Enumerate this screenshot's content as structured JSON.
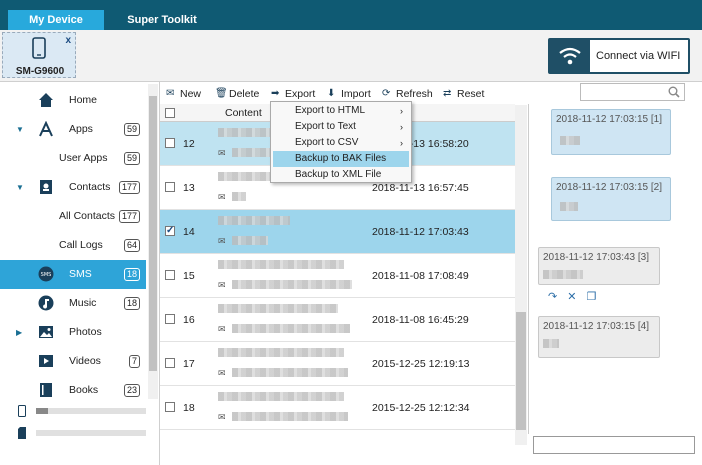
{
  "tabs": {
    "my_device": "My Device",
    "super_toolkit": "Super Toolkit"
  },
  "device": {
    "name": "SM-G9600",
    "close": "x"
  },
  "wifi_button": {
    "label": "Connect via WIFI"
  },
  "sidebar": {
    "items": [
      {
        "label": "Home",
        "icon": "home-icon"
      },
      {
        "label": "Apps",
        "badge": "59",
        "icon": "apps-icon",
        "arrow": "▼"
      },
      {
        "label": "User Apps",
        "badge": "59"
      },
      {
        "label": "Contacts",
        "badge": "177",
        "icon": "contacts-icon",
        "arrow": "▼"
      },
      {
        "label": "All Contacts",
        "badge": "177"
      },
      {
        "label": "Call Logs",
        "badge": "64"
      },
      {
        "label": "SMS",
        "badge": "18",
        "icon": "sms-icon"
      },
      {
        "label": "Music",
        "badge": "18",
        "icon": "music-icon"
      },
      {
        "label": "Photos",
        "icon": "photos-icon",
        "arrow": "▶"
      },
      {
        "label": "Videos",
        "badge": "7",
        "icon": "videos-icon"
      },
      {
        "label": "Books",
        "badge": "23",
        "icon": "books-icon"
      }
    ]
  },
  "toolbar": {
    "new": "New",
    "delete": "Delete",
    "export": "Export",
    "import": "Import",
    "refresh": "Refresh",
    "reset": "Reset"
  },
  "list": {
    "header": {
      "content": "Content"
    },
    "rows": [
      {
        "num": "12",
        "date": "2018-11-13 16:58:20"
      },
      {
        "num": "13",
        "date": "2018-11-13 16:57:45"
      },
      {
        "num": "14",
        "date": "2018-11-12 17:03:43"
      },
      {
        "num": "15",
        "date": "2018-11-08 17:08:49"
      },
      {
        "num": "16",
        "date": "2018-11-08 16:45:29"
      },
      {
        "num": "17",
        "date": "2015-12-25 12:19:13"
      },
      {
        "num": "18",
        "date": "2015-12-25 12:12:34"
      }
    ]
  },
  "export_menu": {
    "items": [
      "Export to HTML",
      "Export to Text",
      "Export to CSV",
      "Backup to BAK Files",
      "Backup to XML File"
    ],
    "arrow": "›"
  },
  "chat": {
    "messages": [
      {
        "date": "2018-11-12 17:03:15",
        "idx": "[1]"
      },
      {
        "date": "2018-11-12 17:03:15",
        "idx": "[2]"
      },
      {
        "date": "2018-11-12 17:03:43",
        "idx": "[3]"
      },
      {
        "date": "2018-11-12 17:03:15",
        "idx": "[4]"
      }
    ]
  },
  "colors": {
    "accent": "#2ea4d8",
    "topbar": "#0f5a73",
    "row_selected": "#9dd5ec"
  }
}
